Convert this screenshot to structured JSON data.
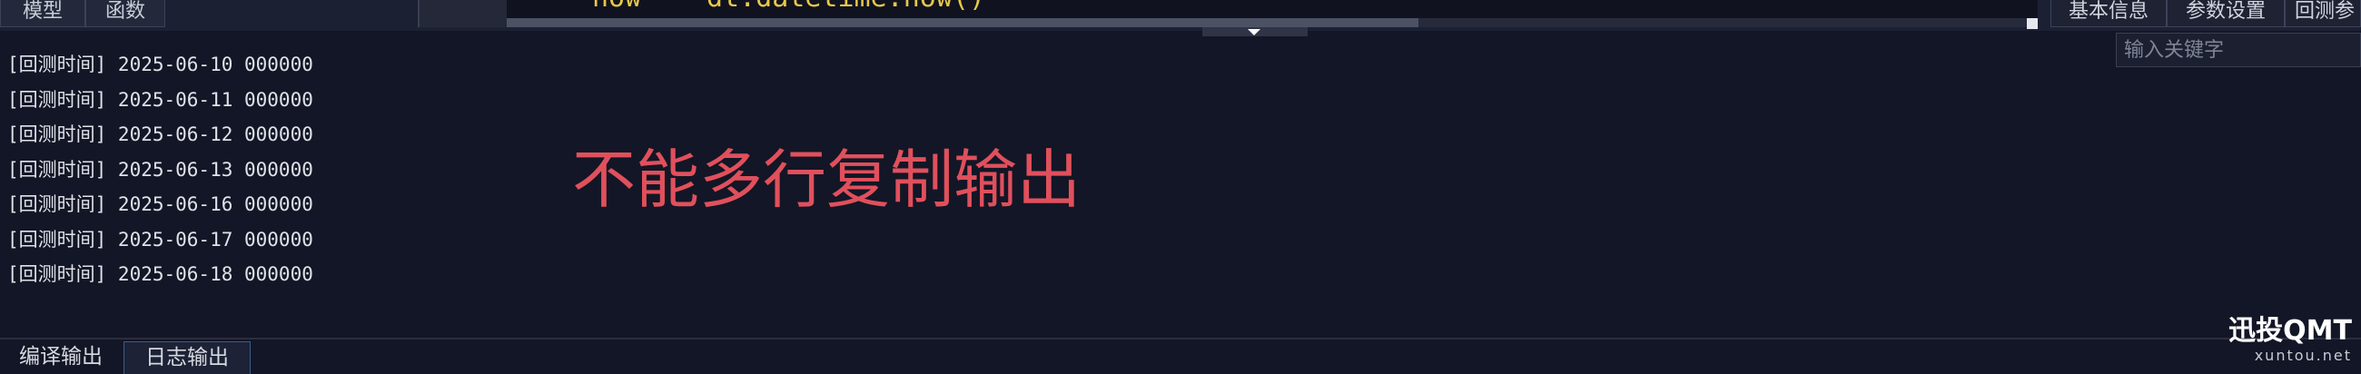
{
  "top_left_tabs": [
    "模型",
    "函数"
  ],
  "code_fragment": {
    "left": "now",
    "right": "dt.datetime.now()"
  },
  "right_tabs": [
    "基本信息",
    "参数设置",
    "回测参"
  ],
  "search": {
    "placeholder": "输入关键字"
  },
  "log_lines": [
    "[回测时间] 2025-06-10 000000",
    "[回测时间] 2025-06-11 000000",
    "[回测时间] 2025-06-12 000000",
    "[回测时间] 2025-06-13 000000",
    "[回测时间] 2025-06-16 000000",
    "[回测时间] 2025-06-17 000000",
    "[回测时间] 2025-06-18 000000"
  ],
  "overlay_text": "不能多行复制输出",
  "bottom_tabs": [
    "编译输出",
    "日志输出"
  ],
  "active_bottom_tab": "日志输出",
  "watermark": {
    "main": "迅投QMT",
    "sub": "xuntou.net"
  },
  "colors": {
    "background": "#131626",
    "overlay": "#e0505c",
    "code": "#e7c84c"
  }
}
